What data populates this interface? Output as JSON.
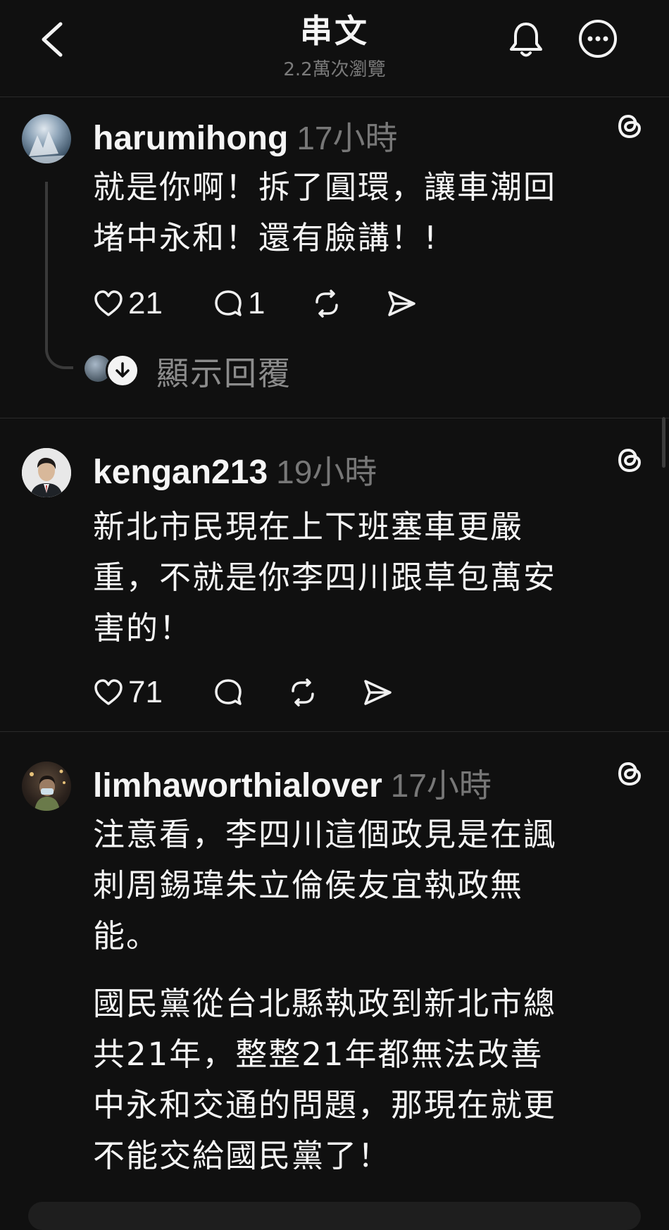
{
  "header": {
    "title": "串文",
    "views": "2.2萬次瀏覽"
  },
  "posts": [
    {
      "username": "harumihong",
      "time": "17小時",
      "text": "就是你啊！拆了圓環，讓車潮回\n堵中永和！還有臉講！!",
      "likes": "21",
      "comments": "1"
    },
    {
      "username": "kengan213",
      "time": "19小時",
      "text": "新北市民現在上下班塞車更嚴\n重，不就是你李四川跟草包萬安\n害的！",
      "likes": "71"
    },
    {
      "username": "limhaworthialover",
      "time": "17小時",
      "text": "注意看，李四川這個政見是在諷\n刺周錫瑋朱立倫侯友宜執政無\n能。",
      "text2": "國民黨從台北縣執政到新北市總\n共21年，整整21年都無法改善\n中永和交通的問題，那現在就更\n不能交給國民黨了！"
    }
  ],
  "show_replies": "顯示回覆"
}
